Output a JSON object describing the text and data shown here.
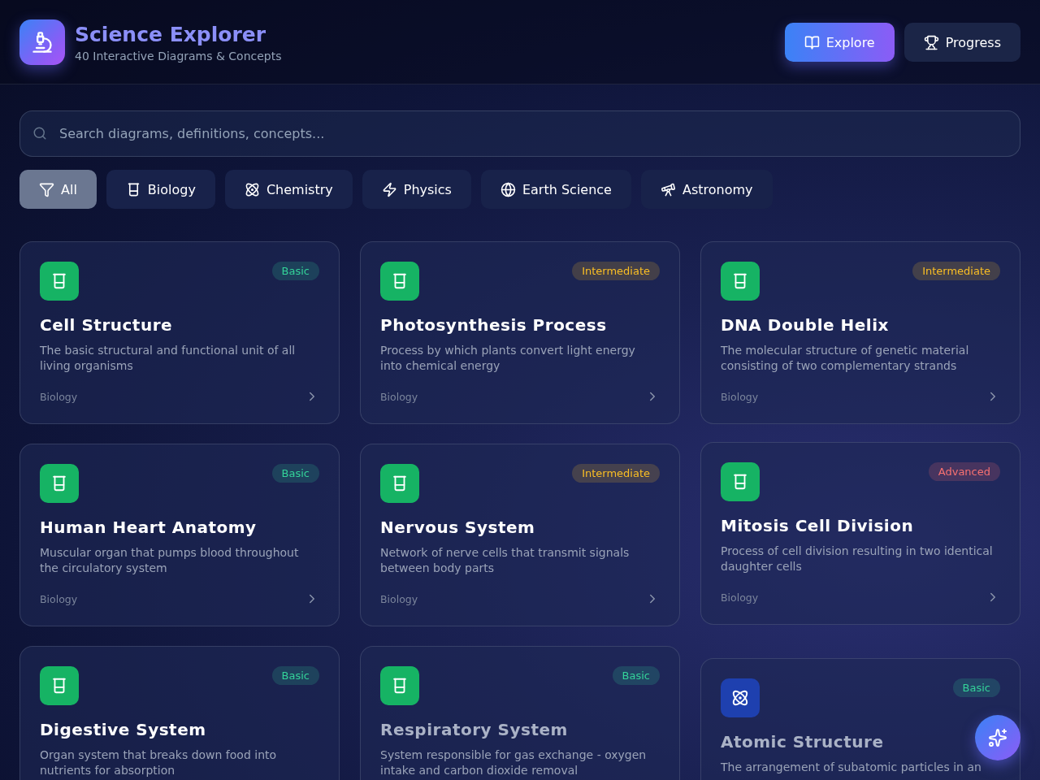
{
  "header": {
    "title": "Science Explorer",
    "subtitle": "40 Interactive Diagrams & Concepts",
    "nav": [
      {
        "label": "Explore",
        "kind": "book",
        "selected": true
      },
      {
        "label": "Progress",
        "kind": "trophy",
        "selected": false
      }
    ]
  },
  "search": {
    "placeholder": "Search diagrams, definitions, concepts..."
  },
  "filters": [
    {
      "label": "All",
      "kind": "filter",
      "selected": true
    },
    {
      "label": "Biology",
      "kind": "beaker",
      "selected": false
    },
    {
      "label": "Chemistry",
      "kind": "atom",
      "selected": false
    },
    {
      "label": "Physics",
      "kind": "bolt",
      "selected": false
    },
    {
      "label": "Earth Science",
      "kind": "globe",
      "selected": false
    },
    {
      "label": "Astronomy",
      "kind": "telescope",
      "selected": false
    }
  ],
  "cards": [
    {
      "kind": "biology",
      "title": "Cell Structure",
      "description": "The basic structural and functional unit of all living organisms",
      "category": "Biology",
      "badge": {
        "text": "Basic",
        "kind": "basic"
      }
    },
    {
      "kind": "biology",
      "title": "Photosynthesis Process",
      "description": "Process by which plants convert light energy into chemical energy",
      "category": "Biology",
      "badge": {
        "text": "Intermediate",
        "kind": "intermediate"
      }
    },
    {
      "kind": "biology",
      "title": "DNA Double Helix",
      "description": "The molecular structure of genetic material consisting of two complementary strands",
      "category": "Biology",
      "badge": {
        "text": "Intermediate",
        "kind": "intermediate"
      }
    },
    {
      "kind": "biology",
      "title": "Human Heart Anatomy",
      "description": "Muscular organ that pumps blood throughout the circulatory system",
      "category": "Biology",
      "badge": {
        "text": "Basic",
        "kind": "basic"
      }
    },
    {
      "kind": "biology",
      "title": "Nervous System",
      "description": "Network of nerve cells that transmit signals between body parts",
      "category": "Biology",
      "badge": {
        "text": "Intermediate",
        "kind": "intermediate"
      }
    },
    {
      "kind": "biology",
      "title": "Mitosis Cell Division",
      "description": "Process of cell division resulting in two identical daughter cells",
      "category": "Biology",
      "badge": {
        "text": "Advanced",
        "kind": "advanced"
      }
    },
    {
      "kind": "biology",
      "title": "Digestive System",
      "description": "Organ system that breaks down food into nutrients for absorption",
      "badge": {
        "text": "Basic",
        "kind": "basic"
      }
    },
    {
      "kind": "biology",
      "title": "Respiratory System",
      "description": "System responsible for gas exchange - oxygen intake and carbon dioxide removal",
      "badge": {
        "text": "Basic",
        "kind": "basic"
      }
    },
    {
      "kind": "chemistry",
      "title": "Atomic Structure",
      "description": "The arrangement of subatomic particles in an",
      "badge": {
        "text": "Basic",
        "kind": "basic"
      }
    }
  ]
}
